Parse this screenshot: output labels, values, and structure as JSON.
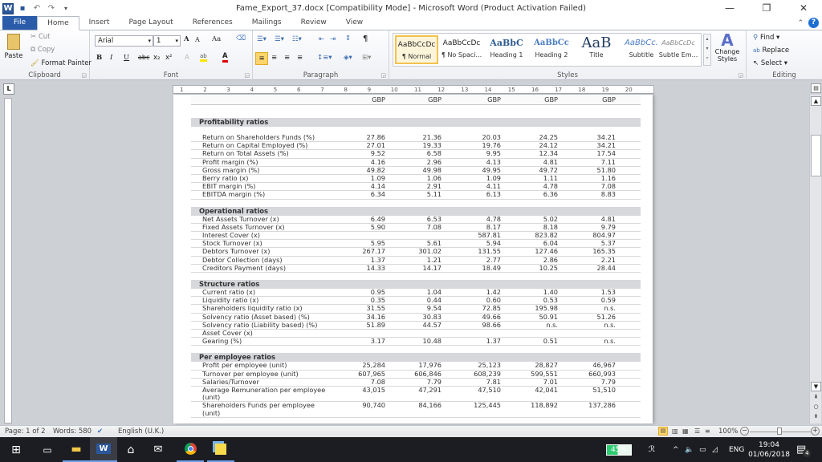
{
  "window": {
    "title": "Fame_Export_37.docx [Compatibility Mode] - Microsoft Word (Product Activation Failed)",
    "controls": [
      "—",
      "❐",
      "✕"
    ]
  },
  "ribbon_tabs": [
    "File",
    "Home",
    "Insert",
    "Page Layout",
    "References",
    "Mailings",
    "Review",
    "View"
  ],
  "active_tab": "Home",
  "clipboard": {
    "paste": "Paste",
    "cut": "Cut",
    "copy": "Copy",
    "format_painter": "Format Painter",
    "label": "Clipboard"
  },
  "font": {
    "name": "Arial",
    "size": "1",
    "label": "Font",
    "grow": "A",
    "shrink": "A",
    "case": "Aa",
    "bold": "B",
    "italic": "I",
    "underline": "U",
    "strike": "abc",
    "sub": "x₂",
    "sup": "x²",
    "text_effects": "A",
    "highlight": "ab",
    "font_color": "A"
  },
  "paragraph": {
    "label": "Paragraph",
    "pilcrow": "¶"
  },
  "styles": {
    "label": "Styles",
    "items": [
      {
        "preview": "AaBbCcDc",
        "name": "¶ Normal"
      },
      {
        "preview": "AaBbCcDc",
        "name": "¶ No Spaci..."
      },
      {
        "preview": "AaBbC",
        "name": "Heading 1"
      },
      {
        "preview": "AaBbCc",
        "name": "Heading 2"
      },
      {
        "preview": "AaB",
        "name": "Title"
      },
      {
        "preview": "AaBbCc.",
        "name": "Subtitle"
      },
      {
        "preview": "AaBbCcDc",
        "name": "Subtle Em..."
      }
    ],
    "change_styles": "Change Styles"
  },
  "editing": {
    "label": "Editing",
    "find": "Find",
    "replace": "Replace",
    "select": "Select"
  },
  "ruler_numbers": [
    "1",
    "2",
    "3",
    "4",
    "5",
    "6",
    "7",
    "8",
    "9",
    "10",
    "11",
    "12",
    "13",
    "14",
    "15",
    "16",
    "17",
    "18",
    "19",
    "20"
  ],
  "table": {
    "currency_headers": [
      "GBP",
      "GBP",
      "GBP",
      "GBP",
      "GBP"
    ],
    "sections": [
      {
        "title": "Profitability ratios",
        "rows": [
          {
            "label": "Return on Shareholders Funds (%)",
            "values": [
              "27.86",
              "21.36",
              "20.03",
              "24.25",
              "34.21"
            ]
          },
          {
            "label": "Return on Capital Employed (%)",
            "values": [
              "27.01",
              "19.33",
              "19.76",
              "24.12",
              "34.21"
            ]
          },
          {
            "label": "Return on Total Assets (%)",
            "values": [
              "9.52",
              "6.58",
              "9.95",
              "12.34",
              "17.54"
            ]
          },
          {
            "label": "Profit margin (%)",
            "values": [
              "4.16",
              "2.96",
              "4.13",
              "4.81",
              "7.11"
            ]
          },
          {
            "label": "Gross margin (%)",
            "values": [
              "49.82",
              "49.98",
              "49.95",
              "49.72",
              "51.80"
            ]
          },
          {
            "label": "Berry ratio (x)",
            "values": [
              "1.09",
              "1.06",
              "1.09",
              "1.11",
              "1.16"
            ]
          },
          {
            "label": "EBIT margin (%)",
            "values": [
              "4.14",
              "2.91",
              "4.11",
              "4.78",
              "7.08"
            ]
          },
          {
            "label": "EBITDA margin (%)",
            "values": [
              "6.34",
              "5.11",
              "6.13",
              "6.36",
              "8.83"
            ]
          }
        ]
      },
      {
        "title": "Operational ratios",
        "rows": [
          {
            "label": "Net Assets Turnover (x)",
            "values": [
              "6.49",
              "6.53",
              "4.78",
              "5.02",
              "4.81"
            ]
          },
          {
            "label": "Fixed Assets Turnover (x)",
            "values": [
              "5.90",
              "7.08",
              "8.17",
              "8.18",
              "9.79"
            ]
          },
          {
            "label": "Interest Cover (x)",
            "values": [
              "",
              "",
              "587.81",
              "823.82",
              "804.97"
            ]
          },
          {
            "label": "Stock Turnover (x)",
            "values": [
              "5.95",
              "5.61",
              "5.94",
              "6.04",
              "5.37"
            ]
          },
          {
            "label": "Debtors Turnover (x)",
            "values": [
              "267.17",
              "301.02",
              "131.55",
              "127.46",
              "165.35"
            ]
          },
          {
            "label": "Debtor Collection (days)",
            "values": [
              "1.37",
              "1.21",
              "2.77",
              "2.86",
              "2.21"
            ]
          },
          {
            "label": "Creditors Payment (days)",
            "values": [
              "14.33",
              "14.17",
              "18.49",
              "10.25",
              "28.44"
            ]
          }
        ]
      },
      {
        "title": "Structure ratios",
        "rows": [
          {
            "label": "Current ratio (x)",
            "values": [
              "0.95",
              "1.04",
              "1.42",
              "1.40",
              "1.53"
            ]
          },
          {
            "label": "Liquidity ratio (x)",
            "values": [
              "0.35",
              "0.44",
              "0.60",
              "0.53",
              "0.59"
            ]
          },
          {
            "label": "Shareholders liquidity ratio (x)",
            "values": [
              "31.55",
              "9.54",
              "72.85",
              "195.98",
              "n.s."
            ]
          },
          {
            "label": "Solvency ratio (Asset based) (%)",
            "values": [
              "34.16",
              "30.83",
              "49.66",
              "50.91",
              "51.26"
            ]
          },
          {
            "label": "Solvency ratio (Liability based) (%)",
            "values": [
              "51.89",
              "44.57",
              "98.66",
              "n.s.",
              "n.s."
            ]
          },
          {
            "label": "Asset Cover (x)",
            "values": [
              "",
              "",
              "",
              "",
              ""
            ]
          },
          {
            "label": "Gearing (%)",
            "values": [
              "3.17",
              "10.48",
              "1.37",
              "0.51",
              "n.s."
            ]
          }
        ]
      },
      {
        "title": "Per employee ratios",
        "rows": [
          {
            "label": "Profit per employee (unit)",
            "values": [
              "25,284",
              "17,976",
              "25,123",
              "28,827",
              "46,967"
            ]
          },
          {
            "label": "Turnover per employee (unit)",
            "values": [
              "607,965",
              "606,846",
              "608,239",
              "599,551",
              "660,993"
            ]
          },
          {
            "label": "Salaries/Turnover",
            "values": [
              "7.08",
              "7.79",
              "7.81",
              "7.01",
              "7.79"
            ]
          },
          {
            "label": "Average Remuneration per employee (unit)",
            "values": [
              "43,015",
              "47,291",
              "47,510",
              "42,041",
              "51,510"
            ]
          },
          {
            "label": "Shareholders Funds per employee (unit)",
            "values": [
              "90,740",
              "84,166",
              "125,445",
              "118,892",
              "137,286"
            ]
          }
        ]
      }
    ]
  },
  "status": {
    "page": "Page: 1 of 2",
    "words": "Words: 580",
    "language": "English (U.K.)",
    "zoom": "100%",
    "zoom_minus": "−",
    "zoom_plus": "+"
  },
  "taskbar": {
    "battery": "45%",
    "lang": "ENG",
    "time": "19:04",
    "date": "01/06/2018",
    "notifications": "4"
  }
}
